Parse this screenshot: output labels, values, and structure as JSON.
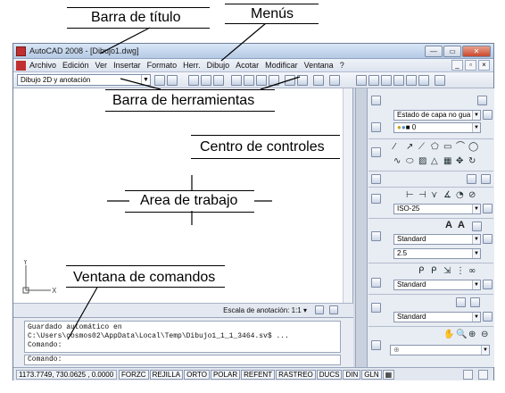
{
  "annotations": {
    "title_bar": "Barra de título",
    "menus": "Menús",
    "toolbars": "Barra de herramientas",
    "dashboard": "Centro de controles",
    "work_area": "Area de trabajo",
    "command_window": "Ventana de comandos"
  },
  "window": {
    "title": "AutoCAD 2008 - [Dibujo1.dwg]"
  },
  "menu": {
    "items": [
      "Archivo",
      "Edición",
      "Ver",
      "Insertar",
      "Formato",
      "Herr.",
      "Dibujo",
      "Acotar",
      "Modificar",
      "Ventana",
      "?"
    ]
  },
  "toolbar": {
    "workspace": "Dibujo 2D y anotación"
  },
  "ucs": {
    "x_label": "X",
    "y_label": "Y"
  },
  "layout_bar": {
    "annotation_scale_label": "Escala de anotación:",
    "annotation_scale_value": "1:1"
  },
  "command": {
    "history_line1": "Guardado automático en",
    "history_line2": "C:\\Users\\cosmos02\\AppData\\Local\\Temp\\Dibujo1_1_1_3464.sv$ ...",
    "history_line3": "Comando:",
    "prompt": "Comando:"
  },
  "status": {
    "coordinates": "1173.7749, 730.0625 , 0.0000",
    "toggles": [
      "FORZC",
      "REJILLA",
      "ORTO",
      "POLAR",
      "REFENT",
      "RASTREO",
      "DUCS",
      "DIN",
      "GLN"
    ]
  },
  "dashboard": {
    "layer_state": "Estado de capa no gua",
    "layer_current": "0",
    "dim_style": "ISO-25",
    "text_style": "Standard",
    "text_height": "2.5",
    "multileader_style": "Standard",
    "table_style": "Standard",
    "text_btn_a": "A"
  }
}
